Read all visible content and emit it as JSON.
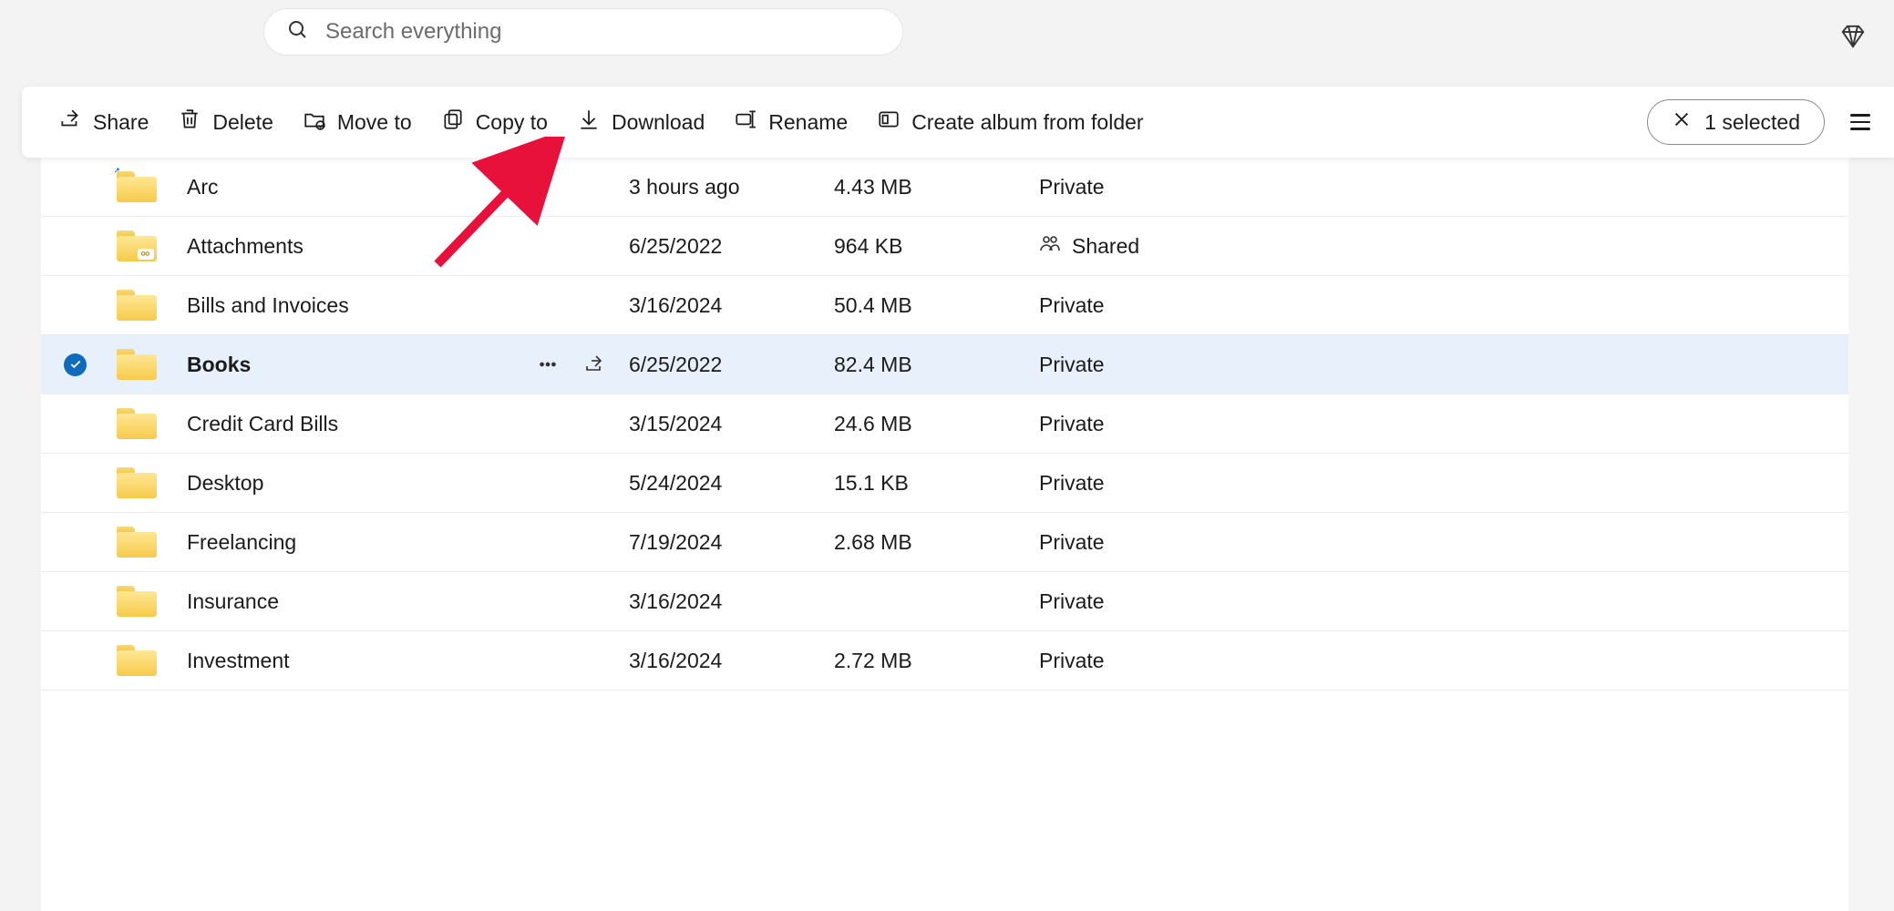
{
  "search": {
    "placeholder": "Search everything"
  },
  "toolbar": {
    "share": "Share",
    "delete": "Delete",
    "move": "Move to",
    "copy": "Copy to",
    "download": "Download",
    "rename": "Rename",
    "album": "Create album from folder",
    "selected": "1 selected"
  },
  "rows": [
    {
      "name": "Arc",
      "modified": "3 hours ago",
      "size": "4.43 MB",
      "sharing": "Private",
      "selected": false,
      "shared_icon": false,
      "tag": "↗"
    },
    {
      "name": "Attachments",
      "modified": "6/25/2022",
      "size": "964 KB",
      "sharing": "Shared",
      "selected": false,
      "shared_icon": true,
      "tag": ""
    },
    {
      "name": "Bills and Invoices",
      "modified": "3/16/2024",
      "size": "50.4 MB",
      "sharing": "Private",
      "selected": false,
      "shared_icon": false,
      "tag": ""
    },
    {
      "name": "Books",
      "modified": "6/25/2022",
      "size": "82.4 MB",
      "sharing": "Private",
      "selected": true,
      "shared_icon": false,
      "tag": ""
    },
    {
      "name": "Credit Card Bills",
      "modified": "3/15/2024",
      "size": "24.6 MB",
      "sharing": "Private",
      "selected": false,
      "shared_icon": false,
      "tag": ""
    },
    {
      "name": "Desktop",
      "modified": "5/24/2024",
      "size": "15.1 KB",
      "sharing": "Private",
      "selected": false,
      "shared_icon": false,
      "tag": ""
    },
    {
      "name": "Freelancing",
      "modified": "7/19/2024",
      "size": "2.68 MB",
      "sharing": "Private",
      "selected": false,
      "shared_icon": false,
      "tag": ""
    },
    {
      "name": "Insurance",
      "modified": "3/16/2024",
      "size": "",
      "sharing": "Private",
      "selected": false,
      "shared_icon": false,
      "tag": ""
    },
    {
      "name": "Investment",
      "modified": "3/16/2024",
      "size": "2.72 MB",
      "sharing": "Private",
      "selected": false,
      "shared_icon": false,
      "tag": ""
    }
  ]
}
